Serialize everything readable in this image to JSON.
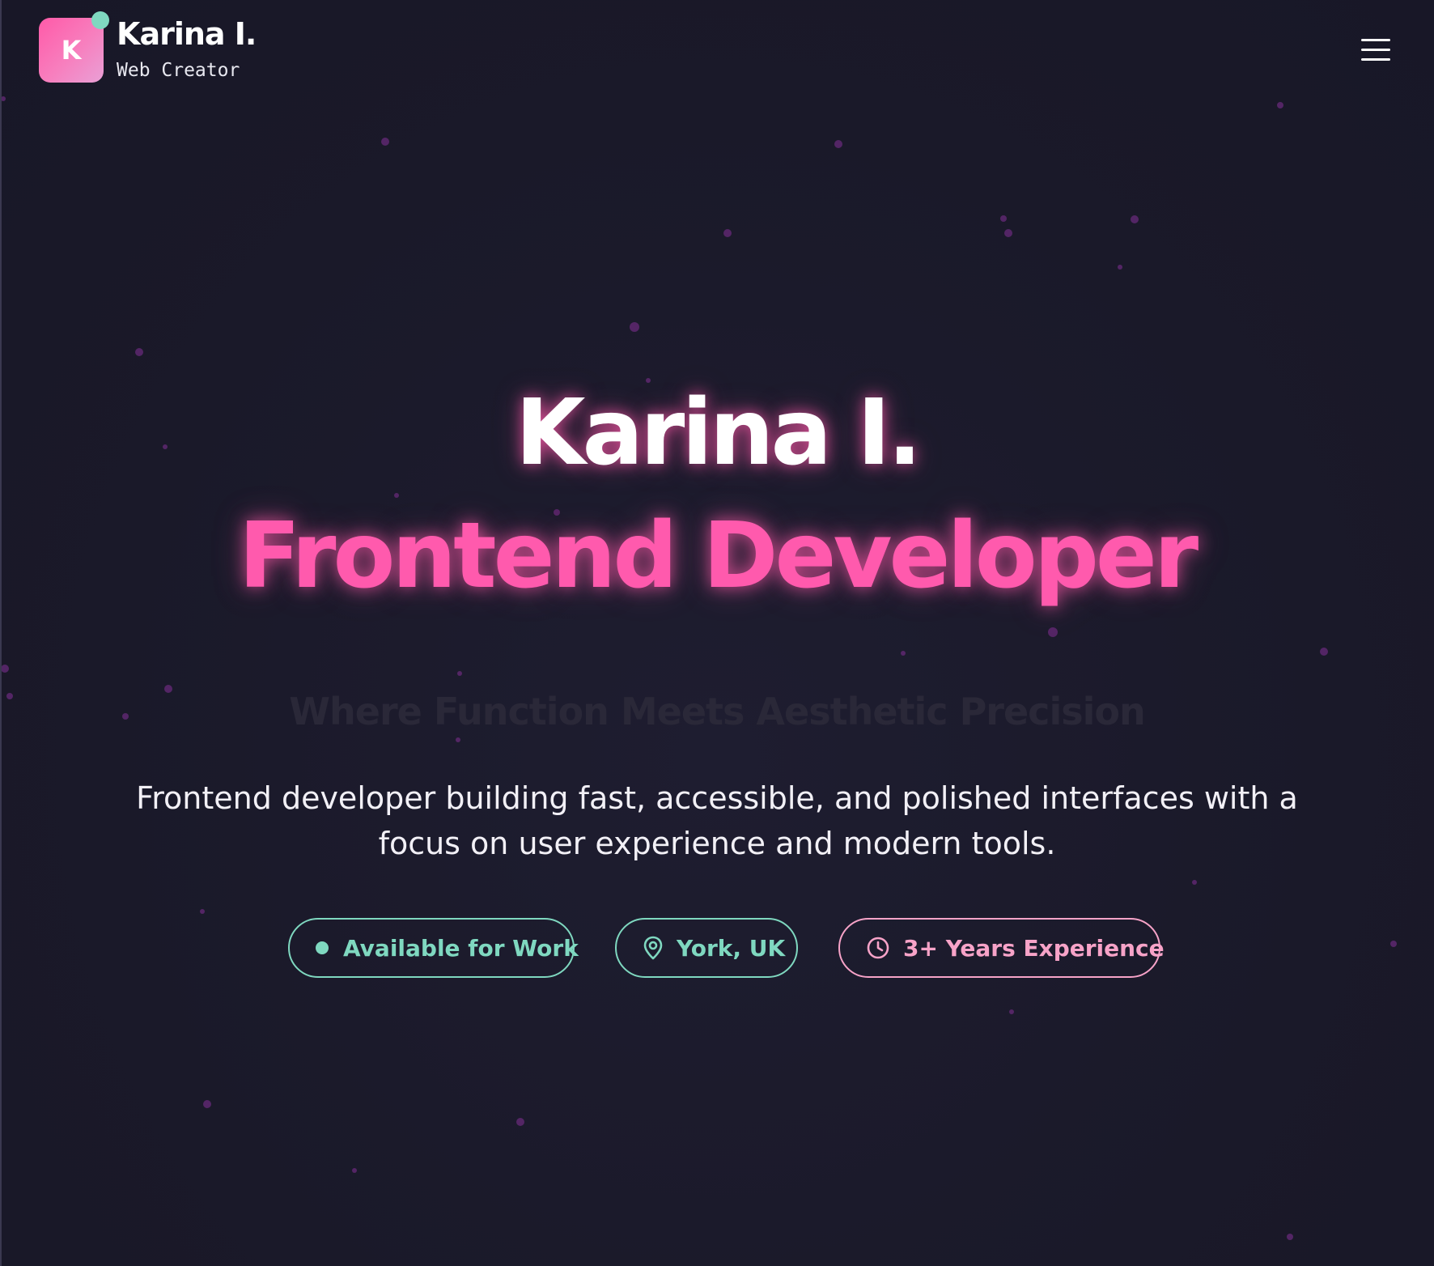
{
  "header": {
    "logo_letter": "K",
    "brand_name": "Karina I.",
    "brand_tagline": "Web Creator",
    "menu_icon": "hamburger-menu-icon"
  },
  "hero": {
    "name": "Karina I.",
    "role": "Frontend Developer",
    "tagline": "Where Function Meets Aesthetic Precision",
    "description": "Frontend developer building fast, accessible, and polished interfaces with a focus on user experience and modern tools."
  },
  "badges": {
    "available": {
      "label": "Available for Work",
      "icon": "status-dot-icon"
    },
    "location": {
      "label": "York, UK",
      "icon": "map-pin-icon"
    },
    "experience": {
      "label": "3+ Years Experience",
      "icon": "clock-icon"
    }
  },
  "colors": {
    "background": "#1b1a2b",
    "accent_pink": "#ff5aad",
    "accent_mint": "#7fd8c0",
    "accent_light_pink": "#f7a3c8",
    "particles": "#6a2a78"
  }
}
